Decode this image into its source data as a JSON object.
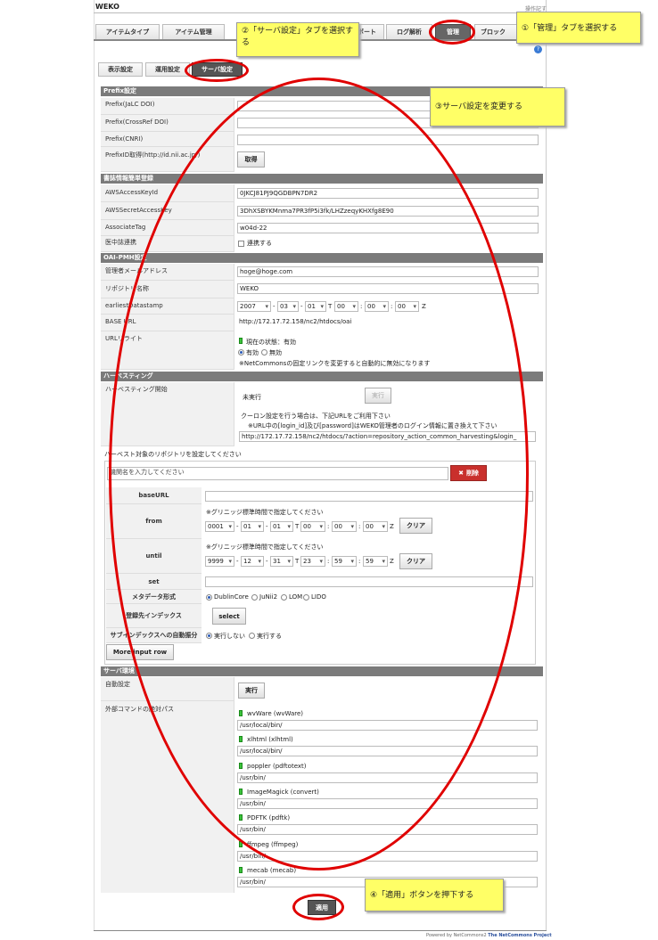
{
  "app": {
    "title": "WEKO",
    "top_right_link": "操作記す",
    "footer_prefix": "Powered by NetCommons2",
    "footer_project": "The NetCommons Project"
  },
  "top_tabs": [
    "アイテムタイプ",
    "アイテム管理",
    "ポート",
    "ログ解析",
    "管理",
    "ブロック"
  ],
  "sub_tabs": [
    "表示設定",
    "運用設定",
    "サーバ設定"
  ],
  "prefix": {
    "header": "Prefix設定",
    "jalc_label": "Prefix(JaLC DOI)",
    "crossref_label": "Prefix(CrossRef DOI)",
    "cnri_label": "Prefix(CNRI)",
    "id_label": "PrefixID取得(http://id.nii.ac.jp/)",
    "get_button": "取得"
  },
  "book": {
    "header": "書誌情報簡単登録",
    "aws_key_label": "AWSAccessKeyId",
    "aws_key_value": "0JKCJ81PJ9QGDBPN7DR2",
    "aws_secret_label": "AWSSecretAccessKey",
    "aws_secret_value": "3DhXSBYKMnma7PR3fP5i3fk/LHZzeqyKHXfg8E90",
    "assoc_label": "AssociateTag",
    "assoc_value": "w04d-22",
    "ichushi_label": "医中誌連携",
    "ichushi_check": "連携する"
  },
  "oai": {
    "header": "OAI-PMH設定",
    "admin_mail_label": "管理者メールアドレス",
    "admin_mail_value": "hoge@hoge.com",
    "repo_name_label": "リポジトリ名称",
    "repo_name_value": "WEKO",
    "earliest_label": "earliestDatastamp",
    "year": "2007",
    "month": "03",
    "day": "01",
    "t": "T",
    "hour": "00",
    "min": "00",
    "sec": "00",
    "z": "Z",
    "base_url_label": "BASE URL",
    "base_url_value": "http://172.17.72.158/nc2/htdocs/oai",
    "rewrite_label": "URLリライト",
    "rewrite_status": "現在の状態：有効",
    "rewrite_on": "有効",
    "rewrite_off": "無効",
    "rewrite_note": "※NetCommonsの固定リンクを変更すると自動的に無効になります"
  },
  "harvest": {
    "header": "ハーベスティング",
    "start_label": "ハーベスティング開始",
    "status": "未実行",
    "run_button": "実行",
    "cron_note1": "クーロン設定を行う場合は、下記URLをご利用下さい",
    "cron_note2": "※URL中の[login_id]及び[password]はWEKO管理者のログイン情報に置き換えて下さい",
    "cron_url": "http://172.17.72.158/nc2/htdocs/?action=repository_action_common_harvesting&login_",
    "target_label": "ハーベスト対象のリポジトリを設定してください",
    "org_placeholder": "機関名を入力してください",
    "delete_button": "削除",
    "baseurl_label": "baseURL",
    "from_label": "from",
    "until_label": "until",
    "gmt_note": "※グリニッジ標準時間で指定してください",
    "from": {
      "y": "0001",
      "m": "01",
      "d": "01",
      "h": "00",
      "mi": "00",
      "s": "00"
    },
    "until": {
      "y": "9999",
      "m": "12",
      "d": "31",
      "h": "23",
      "mi": "59",
      "s": "59"
    },
    "clear_button": "クリア",
    "set_label": "set",
    "meta_label": "メタデータ形式",
    "meta_options": [
      "DublinCore",
      "JuNii2",
      "LOM",
      "LIDO"
    ],
    "index_label": "登録先インデックス",
    "select_button": "select",
    "auto_label": "サブインデックスへの自動振分",
    "auto_off": "実行しない",
    "auto_on": "実行する",
    "more_button": "More input row"
  },
  "server": {
    "header": "サーバ環境",
    "auto_label": "自動設定",
    "run_button": "実行",
    "cmd_label": "外部コマンドの絶対パス",
    "commands": [
      {
        "name": "wvWare (wvWare)",
        "path": "/usr/local/bin/"
      },
      {
        "name": "xlhtml (xlhtml)",
        "path": "/usr/local/bin/"
      },
      {
        "name": "poppler (pdftotext)",
        "path": "/usr/bin/"
      },
      {
        "name": "ImageMagick (convert)",
        "path": "/usr/bin/"
      },
      {
        "name": "PDFTK (pdftk)",
        "path": "/usr/bin/"
      },
      {
        "name": "ffmpeg (ffmpeg)",
        "path": "/usr/bin/"
      },
      {
        "name": "mecab (mecab)",
        "path": "/usr/bin/"
      }
    ]
  },
  "apply_button": "適用",
  "callouts": {
    "c1": "①「管理」タブを選択する",
    "c2": "②「サーバ設定」タブを選択する",
    "c3": "③サーバ設定を変更する",
    "c4": "④「適用」ボタンを押下する"
  },
  "colors": {
    "annotation_red": "#e00000",
    "callout_yellow": "#ffff66",
    "section_gray": "#7b7b7b",
    "delete_red": "#c9302c"
  }
}
